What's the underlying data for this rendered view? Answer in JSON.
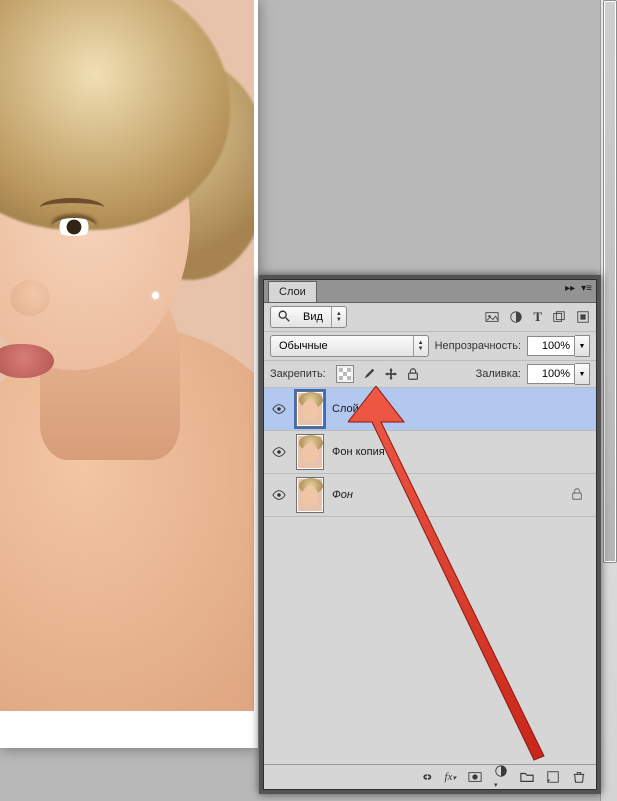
{
  "panel": {
    "tab_label": "Слои",
    "view_label": "Вид",
    "blend_mode": "Обычные",
    "opacity_label": "Непрозрачность:",
    "opacity_value": "100%",
    "lock_label": "Закрепить:",
    "fill_label": "Заливка:",
    "fill_value": "100%",
    "filter_icons": [
      "image-icon",
      "fx-dot-icon",
      "type-icon",
      "shape-icon",
      "smart-icon"
    ],
    "lock_icons": [
      "lock-transparent-icon",
      "brush-icon",
      "move-icon",
      "lock-all-icon"
    ]
  },
  "layers": [
    {
      "name": "Слой 1",
      "selected": true,
      "locked": false,
      "italic": false
    },
    {
      "name": "Фон копия",
      "selected": false,
      "locked": false,
      "italic": false
    },
    {
      "name": "Фон",
      "selected": false,
      "locked": true,
      "italic": true
    }
  ],
  "bottom_icons": [
    "link-icon",
    "fx-icon",
    "mask-icon",
    "adjust-icon",
    "group-icon",
    "new-layer-icon",
    "trash-icon"
  ],
  "colors": {
    "selection": "#b2c8ef",
    "panel_bg": "#d6d6d6",
    "canvas_bg": "#e8c3ac",
    "arrow": "#e03424"
  }
}
